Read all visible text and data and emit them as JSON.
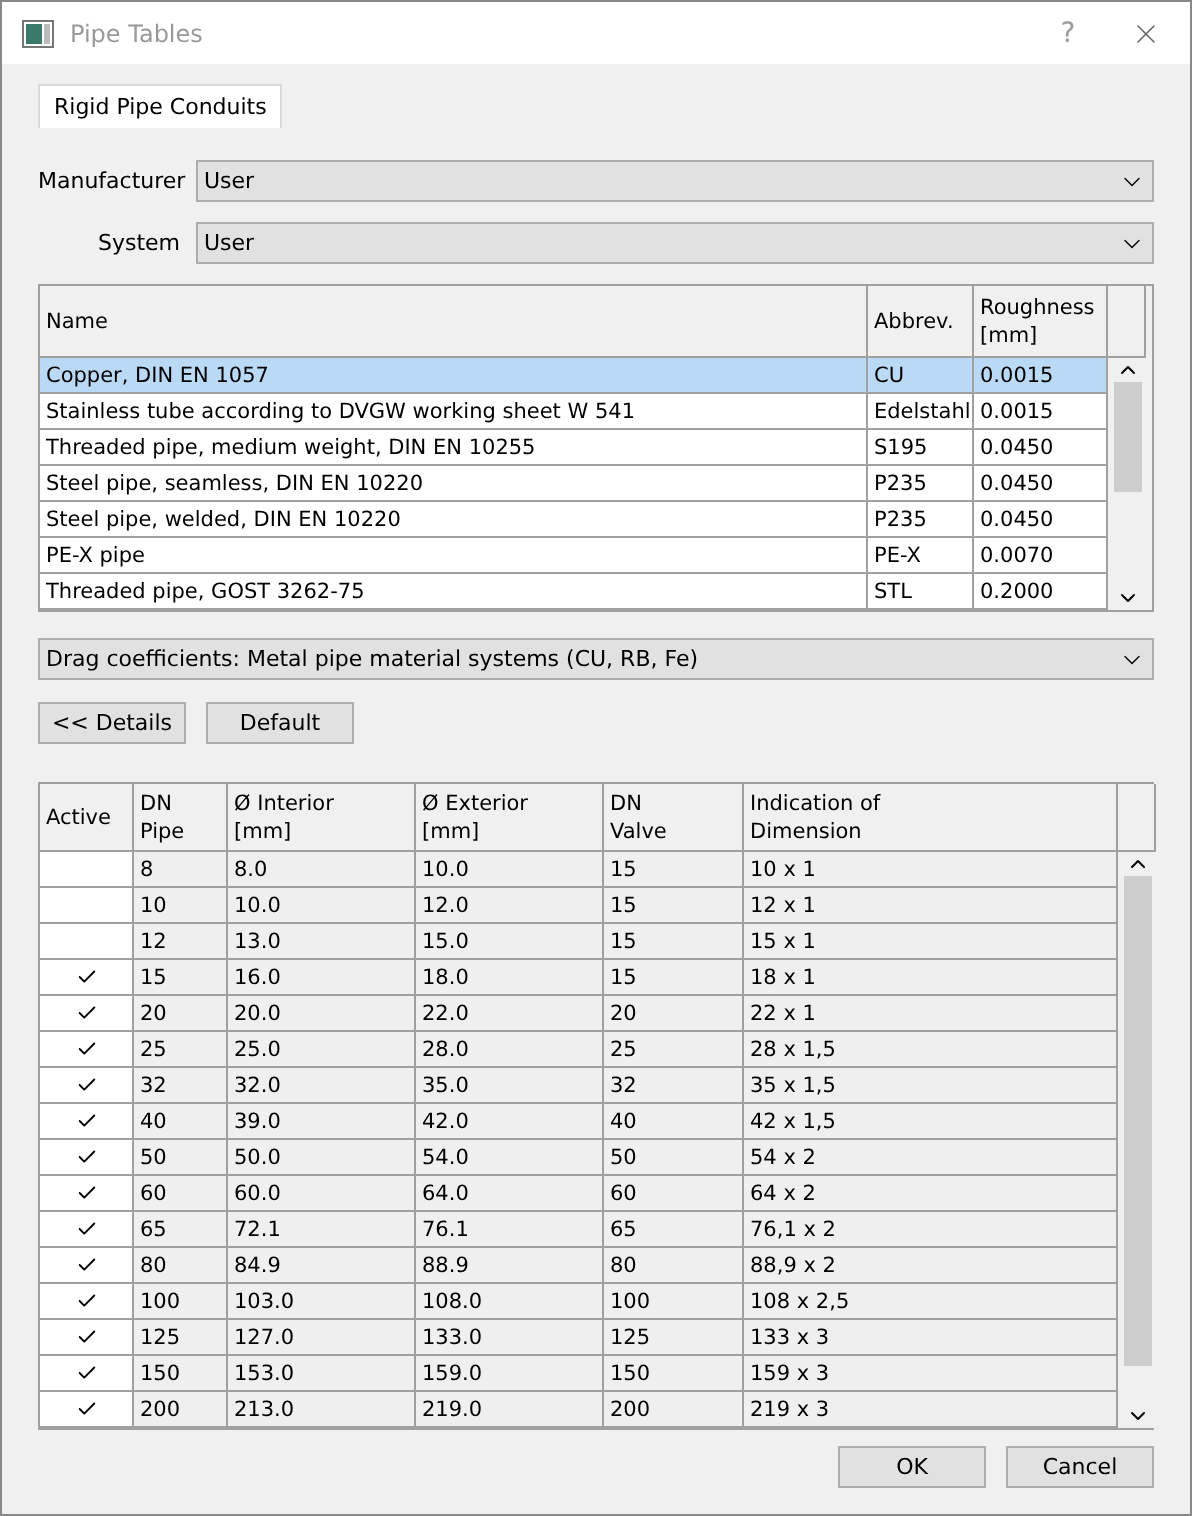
{
  "window": {
    "title": "Pipe Tables",
    "help": "?"
  },
  "tabs": [
    {
      "label": "Rigid Pipe Conduits",
      "selected": true
    }
  ],
  "manufacturer": {
    "label": "Manufacturer",
    "value": "User"
  },
  "system": {
    "label": "System",
    "value": "User"
  },
  "materials": {
    "columns": [
      "Name",
      "Abbrev.",
      "Roughness\n[mm]"
    ],
    "rows": [
      {
        "cells": [
          "Copper, DIN EN 1057",
          "CU",
          "0.0015"
        ],
        "selected": true
      },
      {
        "cells": [
          "Stainless tube according to DVGW working sheet W 541",
          "Edelstahl",
          "0.0015"
        ],
        "selected": false
      },
      {
        "cells": [
          "Threaded pipe, medium weight, DIN EN 10255",
          "S195",
          "0.0450"
        ],
        "selected": false
      },
      {
        "cells": [
          "Steel pipe, seamless, DIN EN 10220",
          "P235",
          "0.0450"
        ],
        "selected": false
      },
      {
        "cells": [
          "Steel pipe, welded, DIN EN 10220",
          "P235",
          "0.0450"
        ],
        "selected": false
      },
      {
        "cells": [
          "PE-X pipe",
          "PE-X",
          "0.0070"
        ],
        "selected": false
      },
      {
        "cells": [
          "Threaded pipe, GOST 3262-75",
          "STL",
          "0.2000"
        ],
        "selected": false
      }
    ]
  },
  "drag_coefficients": {
    "value": "Drag coefficients: Metal pipe material systems (CU, RB, Fe)"
  },
  "buttons": [
    "<< Details",
    "Default"
  ],
  "dimensions": {
    "active_column": "Active",
    "columns": [
      "DN\nPipe",
      "Ø Interior\n[mm]",
      "Ø Exterior\n[mm]",
      "DN\nValve",
      "Indication of\nDimension"
    ],
    "rows": [
      {
        "active": false,
        "cells": [
          "8",
          "8.0",
          "10.0",
          "15",
          "10 x 1"
        ]
      },
      {
        "active": false,
        "cells": [
          "10",
          "10.0",
          "12.0",
          "15",
          "12 x 1"
        ]
      },
      {
        "active": false,
        "cells": [
          "12",
          "13.0",
          "15.0",
          "15",
          "15 x 1"
        ]
      },
      {
        "active": true,
        "cells": [
          "15",
          "16.0",
          "18.0",
          "15",
          "18 x 1"
        ]
      },
      {
        "active": true,
        "cells": [
          "20",
          "20.0",
          "22.0",
          "20",
          "22 x 1"
        ]
      },
      {
        "active": true,
        "cells": [
          "25",
          "25.0",
          "28.0",
          "25",
          "28 x 1,5"
        ]
      },
      {
        "active": true,
        "cells": [
          "32",
          "32.0",
          "35.0",
          "32",
          "35 x 1,5"
        ]
      },
      {
        "active": true,
        "cells": [
          "40",
          "39.0",
          "42.0",
          "40",
          "42 x 1,5"
        ]
      },
      {
        "active": true,
        "cells": [
          "50",
          "50.0",
          "54.0",
          "50",
          "54 x 2"
        ]
      },
      {
        "active": true,
        "cells": [
          "60",
          "60.0",
          "64.0",
          "60",
          "64 x 2"
        ]
      },
      {
        "active": true,
        "cells": [
          "65",
          "72.1",
          "76.1",
          "65",
          "76,1 x 2"
        ]
      },
      {
        "active": true,
        "cells": [
          "80",
          "84.9",
          "88.9",
          "80",
          "88,9 x 2"
        ]
      },
      {
        "active": true,
        "cells": [
          "100",
          "103.0",
          "108.0",
          "100",
          "108 x 2,5"
        ]
      },
      {
        "active": true,
        "cells": [
          "125",
          "127.0",
          "133.0",
          "125",
          "133 x 3"
        ]
      },
      {
        "active": true,
        "cells": [
          "150",
          "153.0",
          "159.0",
          "150",
          "159 x 3"
        ]
      },
      {
        "active": true,
        "cells": [
          "200",
          "213.0",
          "219.0",
          "200",
          "219 x 3"
        ]
      }
    ]
  },
  "dialog_buttons": [
    "OK",
    "Cancel"
  ]
}
